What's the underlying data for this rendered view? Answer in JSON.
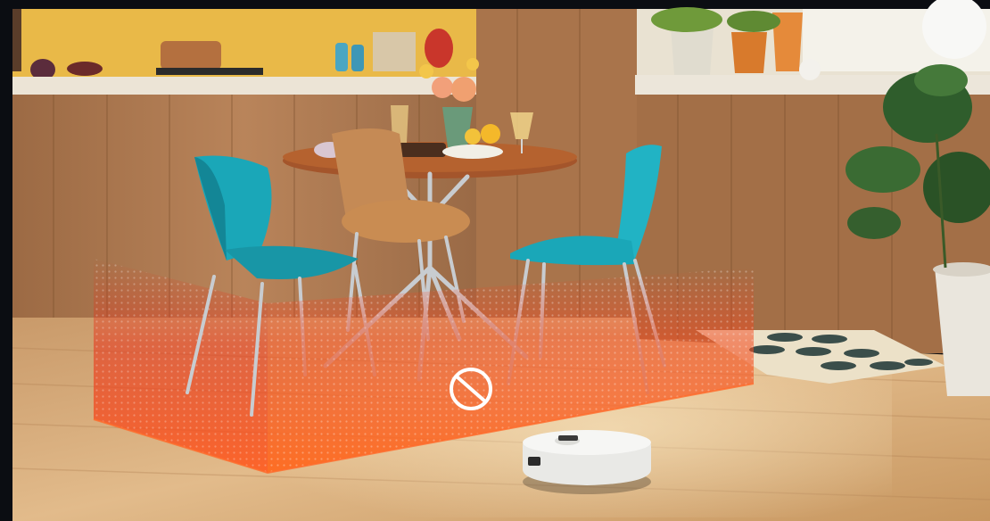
{
  "scene": {
    "subject": "robot-vacuum-no-go-zone",
    "colors": {
      "frame_dark": "#0b0d12",
      "cabinet_wood": "#b07a4f",
      "cabinet_wood_dark": "#8a5a38",
      "wall_yellow": "#e9b948",
      "counter_white": "#ece4d6",
      "floor_wood": "#d0a474",
      "floor_wood_light": "#e6c293",
      "zone_red": "#ee3a1a",
      "zone_orange": "#ff7a2a",
      "chair_teal": "#1aa7b8",
      "chair_teal_dark": "#0f6f7e",
      "chair_wood": "#c58a55",
      "table_wood": "#a4552b",
      "metal": "#c8ccd0",
      "robot_white": "#f3f3f1",
      "rug_cream": "#ece1c8",
      "rug_pattern": "#3b4e4a",
      "plant_green": "#2f5d2c",
      "pot_white": "#eae6dd",
      "no_entry_icon": "#ffffff"
    },
    "icons": [
      "no-entry-icon"
    ]
  }
}
